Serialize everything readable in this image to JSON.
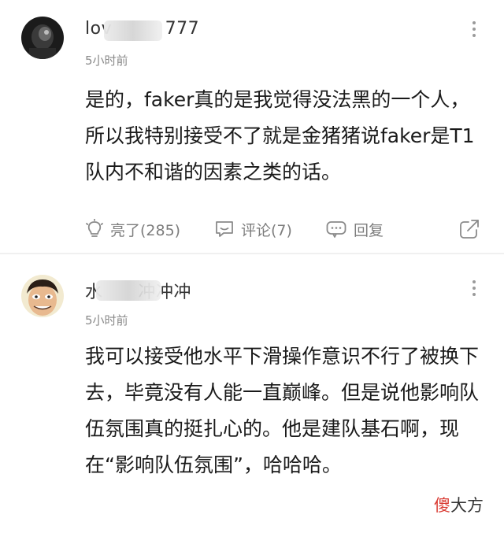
{
  "comments": [
    {
      "username": "lov   777",
      "time": "5小时前",
      "text": "是的，faker真的是我觉得没法黑的一个人，所以我特别接受不了就是金猪猪说faker是T1队内不和谐的因素之类的话。",
      "like_label": "亮了(285)",
      "comment_label": "评论(7)",
      "reply_label": "回复"
    },
    {
      "username": "水  冲冲冲",
      "time": "5小时前",
      "text": "我可以接受他水平下滑操作意识不行了被换下去，毕竟没有人能一直巅峰。但是说他影响队伍氛围真的挺扎心的。他是建队基石啊，现在“影响队伍氛围”，哈哈哈。"
    }
  ],
  "watermark": {
    "part1": "傻",
    "part2": "大方"
  },
  "icons": [
    "more-icon",
    "lightbulb-icon",
    "comment-bubble-icon",
    "reply-bubble-icon",
    "share-icon"
  ],
  "colors": {
    "text": "#1a1a1a",
    "meta": "#8a8a8a",
    "watermark_red": "#d93a32"
  }
}
